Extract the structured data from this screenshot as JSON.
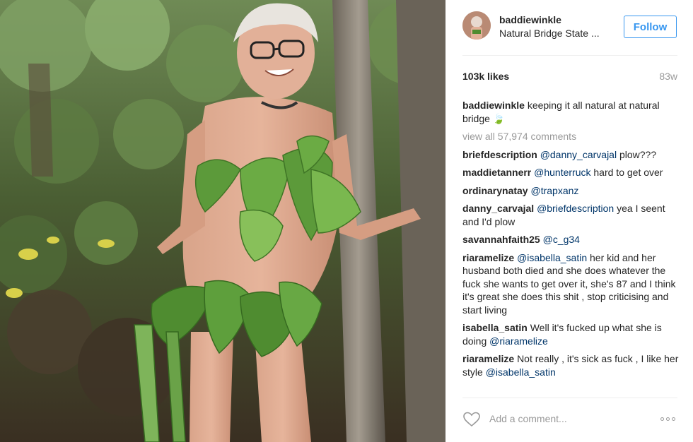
{
  "post": {
    "photo_icon": "forest-photo",
    "header": {
      "username": "baddiewinkle",
      "location": "Natural Bridge State ...",
      "follow_label": "Follow",
      "avatar_icon": "avatar-image"
    },
    "likes": "103k likes",
    "time_ago": "83w",
    "caption": {
      "username": "baddiewinkle",
      "text": "keeping it all natural at natural bridge 🍃"
    },
    "view_all": "view all 57,974 comments",
    "comments": [
      {
        "user": "briefdescription",
        "mention": "@danny_carvajal",
        "text": " plow???"
      },
      {
        "user": "maddietannerr",
        "mention": "@hunterruck",
        "text": " hard to get over"
      },
      {
        "user": "ordinarynatay",
        "mention": "@trapxanz",
        "text": ""
      },
      {
        "user": "danny_carvajal",
        "mention": "@briefdescription",
        "text": " yea I seent and I'd plow"
      },
      {
        "user": "savannahfaith25",
        "mention": "@c_g34",
        "text": ""
      },
      {
        "user": "riaramelize",
        "mention": "@isabella_satin",
        "text": " her kid and her husband both died and she does whatever the fuck she wants to get over it, she's 87 and I think it's great she does this shit , stop criticising and start living"
      },
      {
        "user": "isabella_satin",
        "mention": "",
        "text": "Well it's fucked up what she is doing ",
        "mention_end": "@riaramelize"
      },
      {
        "user": "riaramelize",
        "mention": "",
        "text": "Not really , it's sick as fuck , I like her style ",
        "mention_end": "@isabella_satin"
      }
    ],
    "add_comment_placeholder": "Add a comment...",
    "icons": {
      "like": "heart-icon",
      "more": "more-options-icon"
    },
    "colors": {
      "accent": "#3897f0",
      "mention": "#003569",
      "muted": "#999999"
    }
  }
}
